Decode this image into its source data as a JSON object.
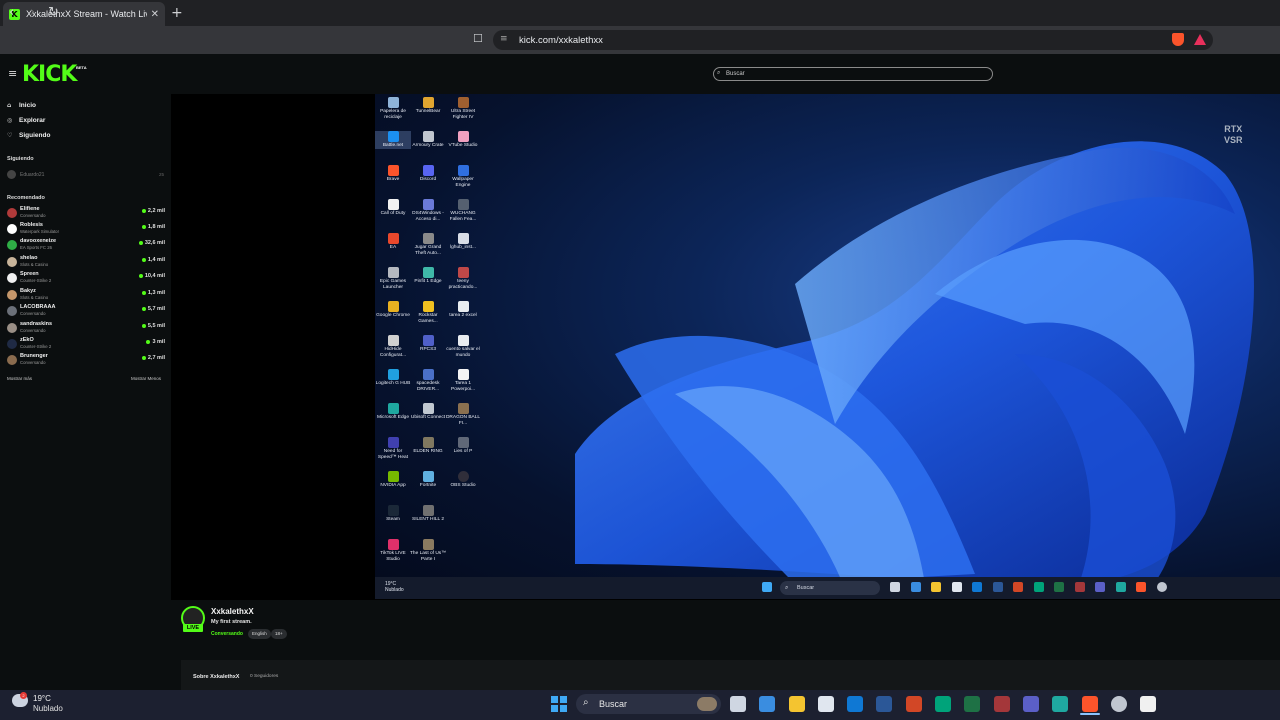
{
  "browser": {
    "tab_title": "XxkalethxX Stream - Watch Live",
    "tab_favicon": "K",
    "tab_close": "✕",
    "new_tab": "+",
    "url": "kick.com/xxkalethxx"
  },
  "kick": {
    "logo": "KICK",
    "beta": "BETA",
    "search_placeholder": "Buscar",
    "accent_color": "#53fc18"
  },
  "sidebar": {
    "nav": [
      {
        "label": "Inicio",
        "icon": "home-icon"
      },
      {
        "label": "Explorar",
        "icon": "compass-icon"
      },
      {
        "label": "Siguiendo",
        "icon": "heart-icon"
      }
    ],
    "following_label": "Siguiendo",
    "following_item": {
      "name": "Eduardo21",
      "count": "25"
    },
    "recommended_label": "Recomendado",
    "recommended": [
      {
        "name": "Elifiene",
        "category": "Conversando",
        "viewers": "2,2 mil"
      },
      {
        "name": "Roblesis",
        "category": "Waterpark Simulator",
        "viewers": "1,8 mil"
      },
      {
        "name": "davooxeneize",
        "category": "EA Sports FC 26",
        "viewers": "32,6 mil"
      },
      {
        "name": "shelao",
        "category": "Slots & Casino",
        "viewers": "1,4 mil"
      },
      {
        "name": "Spreen",
        "category": "Counter-Strike 2",
        "viewers": "10,4 mil"
      },
      {
        "name": "Bakyz",
        "category": "Slots & Casino",
        "viewers": "1,3 mil"
      },
      {
        "name": "LACOBRAAA",
        "category": "Conversando",
        "viewers": "5,7 mil"
      },
      {
        "name": "sandraskins",
        "category": "Conversando",
        "viewers": "5,5 mil"
      },
      {
        "name": "zEkO",
        "category": "Counter-Strike 2",
        "viewers": "3 mil"
      },
      {
        "name": "Brunenger",
        "category": "Conversando",
        "viewers": "2,7 mil"
      }
    ],
    "show_more": "Mostrar más",
    "show_less": "Mostrar Menos"
  },
  "stream_desktop": {
    "rtx_line1": "RTX",
    "rtx_line2": "VSR",
    "icons": [
      [
        "Papelera de reciclaje",
        "TunnelBear",
        "Ultra Street Fighter IV"
      ],
      [
        "Battle.net",
        "Armoury Crate",
        "VTube Studio"
      ],
      [
        "Brave",
        "Discord",
        "Wallpaper Engine"
      ],
      [
        "Call of Duty",
        "DS4Windows - Acceso di...",
        "WUCHANG Fallen Fea..."
      ],
      [
        "EA",
        "Jugar Grand Theft Auto...",
        "lghub_inst..."
      ],
      [
        "Epic Games Launcher",
        "Pinfit 1 Edge",
        "teeny practicando..."
      ],
      [
        "Google Chrome",
        "Rockstar Games...",
        "tarea 2 excel"
      ],
      [
        "HidHide Configurat...",
        "RPCS3",
        "cuento salvar el mundo"
      ],
      [
        "Logitech G HUB",
        "spacedesk DRIVER...",
        "Tarea 1 Powerpoi..."
      ],
      [
        "Microsoft Edge",
        "Ubisoft Connect",
        "DRAGON BALL FI..."
      ],
      [
        "Need for Speed™ Heat",
        "ELDEN RING",
        "Lies of P"
      ],
      [
        "NVIDIA App",
        "Fortnite",
        "OBS Studio"
      ],
      [
        "Steam",
        "SILENT HILL 2",
        ""
      ],
      [
        "TikTok LIVE Studio",
        "The Last of Us™ Parte I",
        ""
      ]
    ],
    "taskbar_temp": "19°C",
    "taskbar_weather": "Nublado",
    "taskbar_search": "Buscar"
  },
  "channel": {
    "name": "XxkalethxX",
    "live_badge": "LIVE",
    "stream_title": "My first stream.",
    "category": "Conversando",
    "tags": [
      "English",
      "18+"
    ],
    "about_title": "Sobre XxkalethxX",
    "followers": "0 Seguidores"
  },
  "taskbar": {
    "temp": "19°C",
    "weather": "Nublado",
    "search": "Buscar",
    "weather_badge": "2"
  }
}
